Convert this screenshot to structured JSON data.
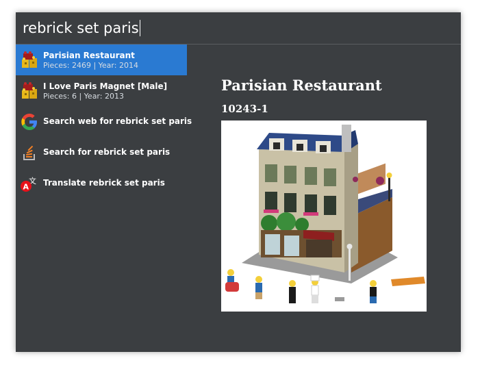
{
  "search": {
    "query": "rebrick set paris"
  },
  "results": [
    {
      "title": "Parisian Restaurant",
      "subtitle": "Pieces: 2469 | Year: 2014",
      "icon": "lego-bricks-icon",
      "selected": true
    },
    {
      "title": "I Love Paris Magnet [Male]",
      "subtitle": "Pieces: 6 | Year: 2013",
      "icon": "lego-bricks-icon"
    },
    {
      "title": "Search web for rebrick set paris",
      "icon": "google-icon"
    },
    {
      "title": "Search for rebrick set paris",
      "icon": "stackoverflow-icon"
    },
    {
      "title": "Translate rebrick set paris",
      "icon": "translate-icon"
    }
  ],
  "preview": {
    "title": "Parisian Restaurant",
    "set_number": "10243-1",
    "image": "lego-parisian-restaurant-set-image"
  },
  "colors": {
    "panel": "#3b3e41",
    "selection": "#2a7ad2",
    "text": "#ffffff"
  }
}
